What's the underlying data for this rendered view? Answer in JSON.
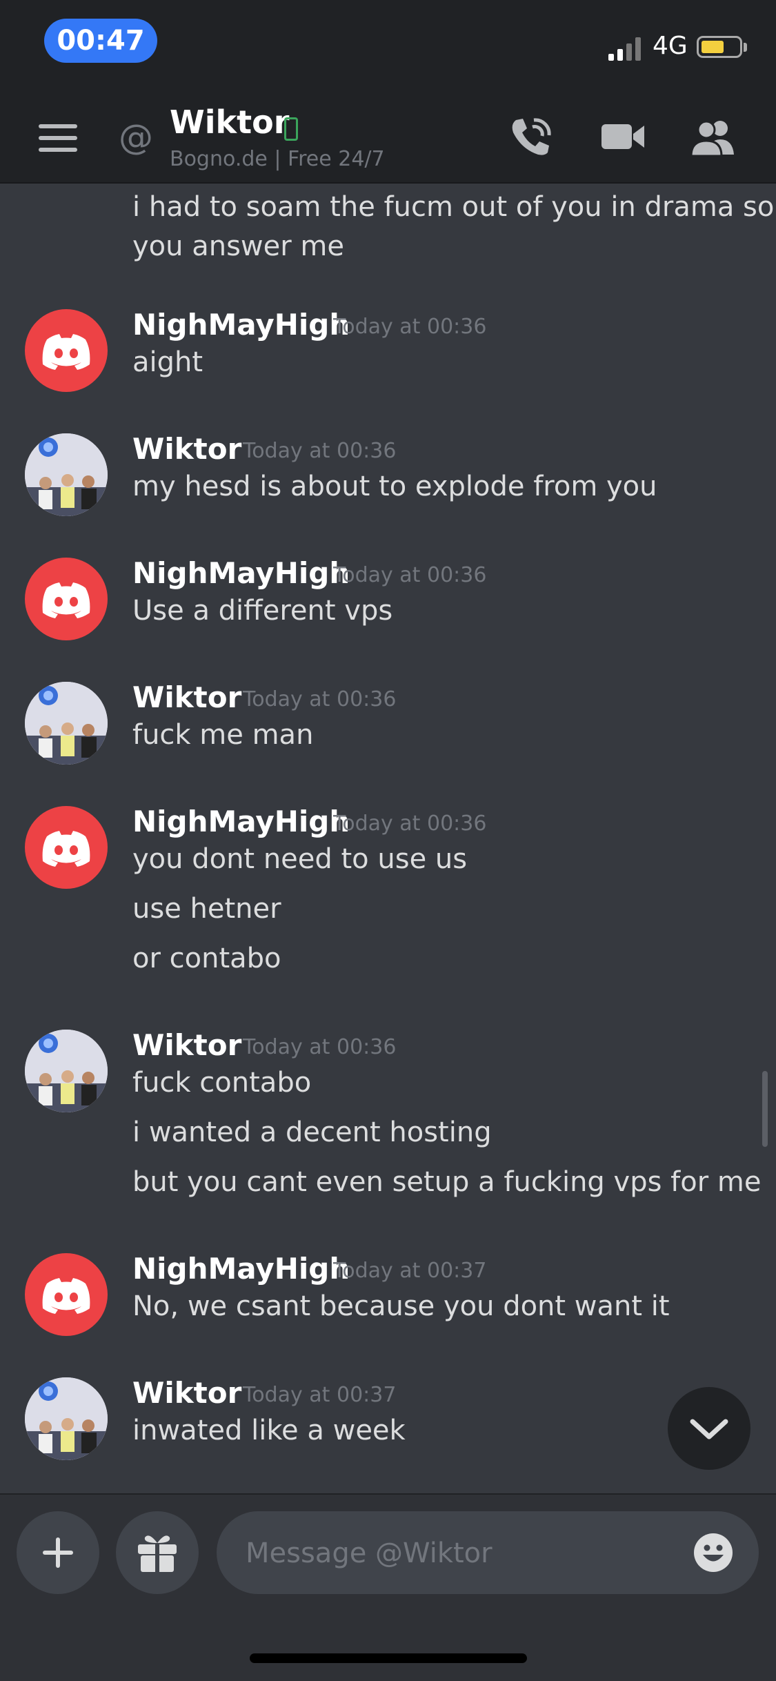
{
  "status_bar": {
    "time": "00:47",
    "network": "4G"
  },
  "header": {
    "name": "Wiktor",
    "status_text": "Bogno.de  | Free 24/7"
  },
  "messages": [
    {
      "lines": [
        "i had to soam the fucm out of you in drama so",
        "you answer me"
      ]
    },
    {
      "author": "NighMayHigh",
      "time": "Today at 00:36",
      "lines": [
        "aight"
      ]
    },
    {
      "author": "Wiktor",
      "time": "Today at 00:36",
      "lines": [
        "my hesd is about to explode from you"
      ]
    },
    {
      "author": "NighMayHigh",
      "time": "Today at 00:36",
      "lines": [
        "Use a different vps"
      ]
    },
    {
      "author": "Wiktor",
      "time": "Today at 00:36",
      "lines": [
        "fuck me man"
      ]
    },
    {
      "author": "NighMayHigh",
      "time": "Today at 00:36",
      "lines": [
        "you dont need to use us",
        "use hetner",
        "or contabo"
      ]
    },
    {
      "author": "Wiktor",
      "time": "Today at 00:36",
      "lines": [
        "fuck contabo",
        "i wanted a decent hosting",
        "but you cant even setup a fucking vps for me"
      ]
    },
    {
      "author": "NighMayHigh",
      "time": "Today at 00:37",
      "lines": [
        "No, we csant because you dont want it"
      ]
    },
    {
      "author": "Wiktor",
      "time": "Today at 00:37",
      "lines": [
        "inwated like a week"
      ]
    }
  ],
  "composer": {
    "placeholder": "Message @Wiktor"
  },
  "colors": {
    "accent": "#3478f6",
    "discord_red": "#ed4245",
    "online_green": "#3ba55c",
    "battery": "#f4d03f"
  },
  "icons": [
    "menu-icon",
    "at-icon",
    "phone-icon",
    "voice-call-icon",
    "video-call-icon",
    "members-icon",
    "chevron-down-icon",
    "plus-icon",
    "gift-icon",
    "emoji-icon",
    "discord-logo-icon"
  ]
}
